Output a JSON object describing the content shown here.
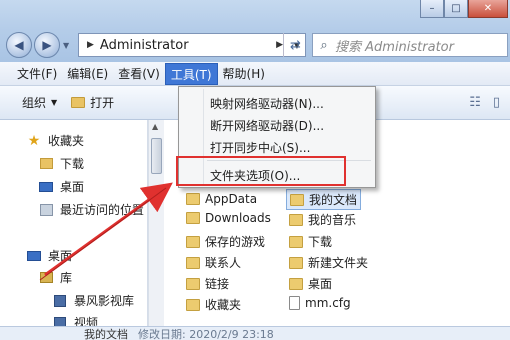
{
  "address": {
    "path": "Administrator"
  },
  "search": {
    "placeholder": "搜索 Administrator"
  },
  "menubar": [
    "文件(F)",
    "编辑(E)",
    "查看(V)",
    "工具(T)",
    "帮助(H)"
  ],
  "toolbar": {
    "organize": "组织",
    "open": "打开"
  },
  "tools_menu": {
    "items": [
      "映射网络驱动器(N)...",
      "断开网络驱动器(D)...",
      "打开同步中心(S)...",
      "文件夹选项(O)..."
    ]
  },
  "sidebar": {
    "favorites": "收藏夹",
    "downloads": "下载",
    "desktop": "桌面",
    "recent": "最近访问的位置",
    "desktop2": "桌面",
    "library": "库",
    "video": "暴风影视库",
    "videos": "视频"
  },
  "files": {
    "col1": [
      "AppData",
      "Downloads",
      "保存的游戏",
      "联系人",
      "链接",
      "收藏夹"
    ],
    "col2": [
      "我的文档",
      "我的音乐",
      "下载",
      "新建文件夹",
      "桌面",
      "mm.cfg"
    ]
  },
  "status": {
    "name": "我的文档",
    "meta": "修改日期: 2020/2/9 23:18"
  },
  "colors": {
    "highlight_red": "#e0312f",
    "menu_active": "#3f77d6"
  }
}
